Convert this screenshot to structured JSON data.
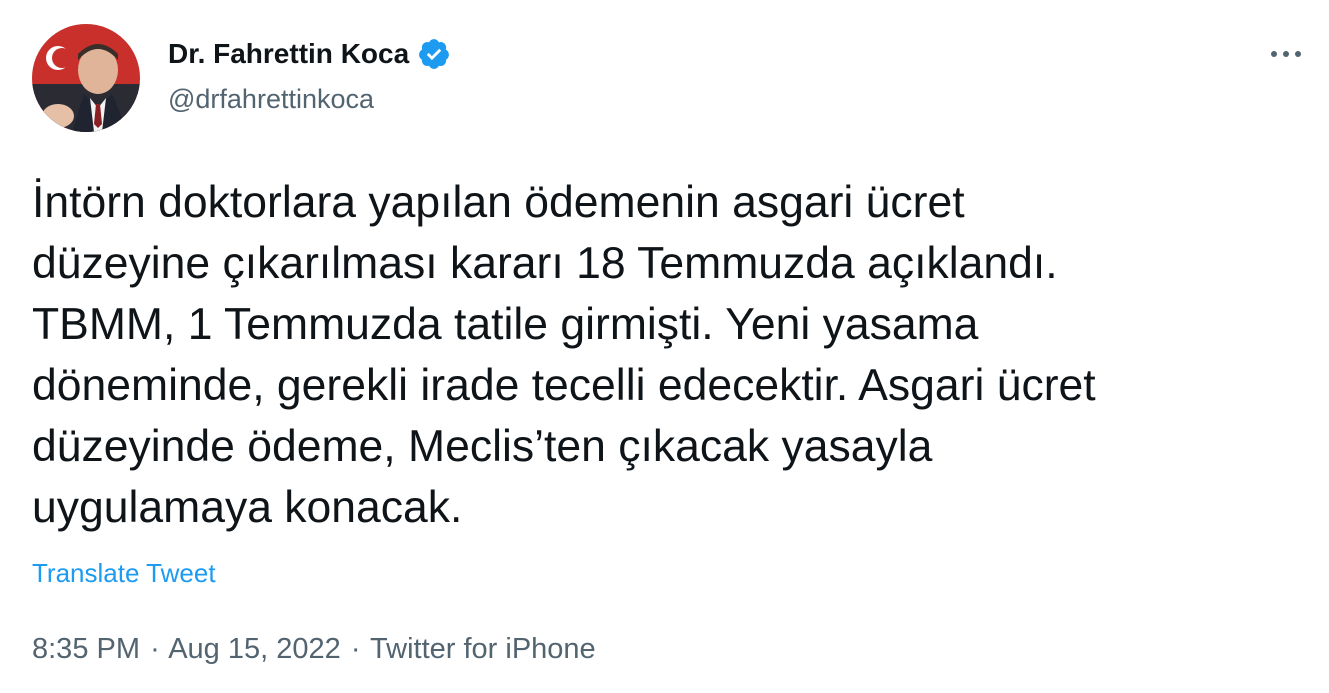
{
  "author": {
    "display_name": "Dr. Fahrettin Koca",
    "handle": "@drfahrettinkoca",
    "verified": true
  },
  "tweet": {
    "text_lines": [
      "İntörn doktorlara yapılan ödemenin asgari ücret",
      "düzeyine çıkarılması kararı 18 Temmuzda açıklandı.",
      "TBMM, 1 Temmuzda tatile girmişti. Yeni yasama",
      "döneminde, gerekli irade tecelli edecektir. Asgari ücret",
      "düzeyinde ödeme, Meclis’ten çıkacak yasayla",
      "uygulamaya konacak."
    ],
    "translate_label": "Translate Tweet",
    "time": "8:35 PM",
    "separator": "·",
    "date": "Aug 15, 2022",
    "source": "Twitter for iPhone"
  },
  "icons": {
    "verified": "verified-badge-icon",
    "more": "more-options-icon"
  },
  "colors": {
    "text_primary": "#0f1419",
    "text_secondary": "#536471",
    "link": "#1d9bf0",
    "verified": "#1d9bf0",
    "background": "#ffffff"
  }
}
